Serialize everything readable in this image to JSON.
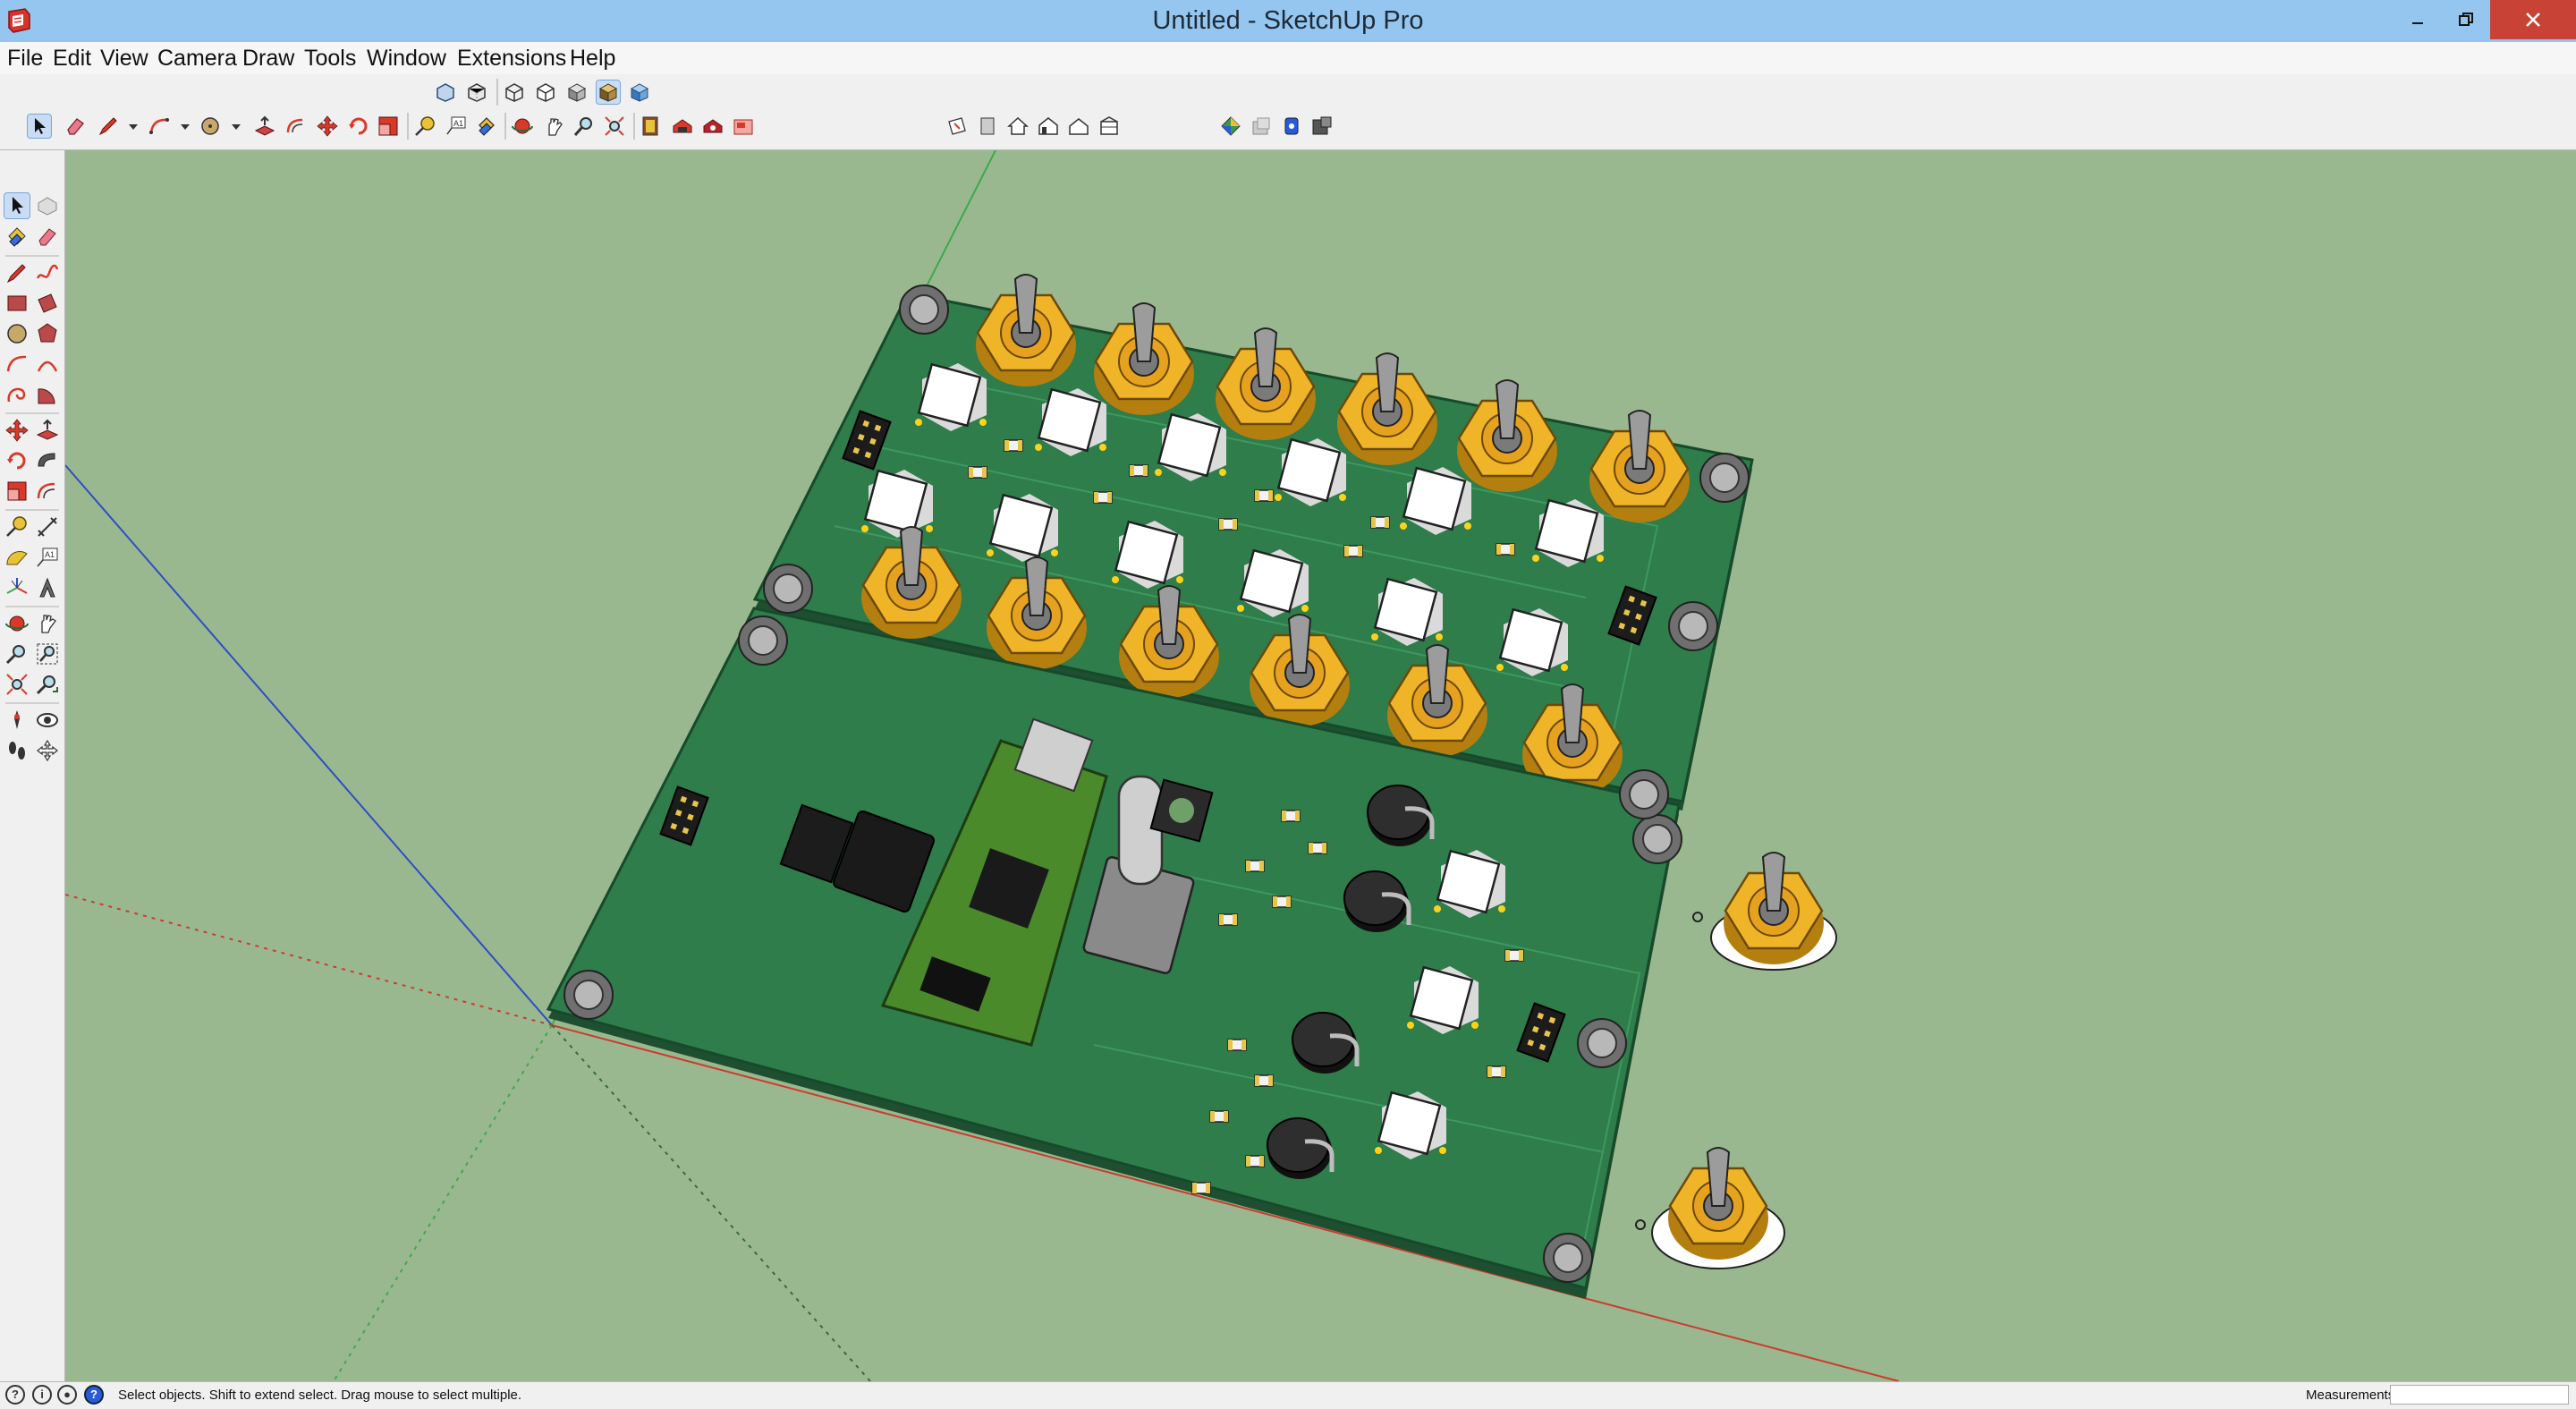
{
  "window": {
    "title": "Untitled - SketchUp Pro",
    "controls": {
      "minimize": "minimize-icon",
      "maximize": "restore-icon",
      "close": "close-icon"
    }
  },
  "menu": {
    "items": [
      "File",
      "Edit",
      "View",
      "Camera",
      "Draw",
      "Tools",
      "Window",
      "Extensions",
      "Help"
    ]
  },
  "toolbars": {
    "views": [
      "iso-view-icon",
      "top-view-icon",
      "front-view-icon",
      "right-view-icon",
      "back-view-icon",
      "left-view-icon"
    ],
    "styles": [
      "xray-icon",
      "back-edges-icon",
      "wireframe-icon",
      "hidden-line-icon",
      "shaded-icon",
      "shaded-textures-icon",
      "monochrome-icon"
    ],
    "getting_started": [
      "select-icon",
      "eraser-icon",
      "pencil-icon",
      "arc-icon",
      "shape-icon",
      "push-pull-icon",
      "offset-icon",
      "move-icon",
      "rotate-icon",
      "scale-icon",
      "tape-measure-icon",
      "text-icon",
      "paint-bucket-icon",
      "orbit-icon",
      "pan-icon",
      "zoom-icon",
      "zoom-extents-icon",
      "model-info-icon",
      "3d-warehouse-icon",
      "extension-warehouse-icon",
      "layout-icon"
    ],
    "warehouse": [
      "section-plane-icon",
      "house-icon",
      "house-front-icon",
      "house-side-icon",
      "house-top-icon",
      "component-icon",
      "geo-location-icon",
      "photo-textures-icon",
      "trimble-connect-icon",
      "extension-icon"
    ]
  },
  "left_toolbar": {
    "tools": [
      "select-icon",
      "make-component-icon",
      "paint-bucket-icon",
      "eraser-icon",
      "line-icon",
      "freehand-icon",
      "rectangle-icon",
      "rotated-rectangle-icon",
      "circle-icon",
      "polygon-icon",
      "arc-icon",
      "two-point-arc-icon",
      "three-point-arc-icon",
      "pie-icon",
      "move-icon",
      "push-pull-icon",
      "rotate-icon",
      "follow-me-icon",
      "scale-icon",
      "offset-icon",
      "tape-measure-icon",
      "dimension-icon",
      "protractor-icon",
      "text-icon",
      "axes-icon",
      "3d-text-icon",
      "orbit-icon",
      "pan-icon",
      "zoom-icon",
      "zoom-window-icon",
      "zoom-extents-icon",
      "previous-view-icon",
      "position-camera-icon",
      "look-around-icon",
      "walk-icon",
      "section-plane-icon"
    ]
  },
  "status": {
    "text": "Select objects. Shift to extend select. Drag mouse to select multiple.",
    "measurements_label": "Measurements",
    "measurements_value": ""
  },
  "colors": {
    "title_bar": "#94c6f0",
    "close_button": "#c84235",
    "viewport_bg": "#9ab890",
    "pcb_green": "#2e7d4a",
    "pcb_edge": "#1d4f30",
    "gold": "#f0b429",
    "axis_red": "#cc3b2e",
    "axis_green": "#3fa84a",
    "axis_blue": "#2d4fc2"
  }
}
